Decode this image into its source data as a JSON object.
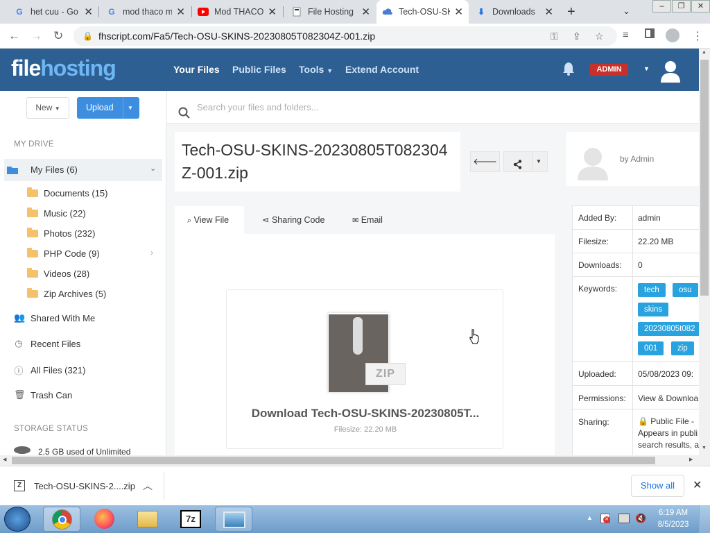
{
  "browser": {
    "tabs": [
      {
        "title": "het cuu - Go",
        "icon": "google-icon"
      },
      {
        "title": "mod thaco m",
        "icon": "google-icon"
      },
      {
        "title": "Mod THACO",
        "icon": "youtube-icon"
      },
      {
        "title": "File Hosting",
        "icon": "filehosting-icon"
      },
      {
        "title": "Tech-OSU-SK",
        "icon": "cloud-icon",
        "active": true
      },
      {
        "title": "Downloads",
        "icon": "download-icon"
      }
    ],
    "url": "fhscript.com/Fa5/Tech-OSU-SKINS-20230805T082304Z-001.zip"
  },
  "site": {
    "logo_a": "file",
    "logo_b": "hosting",
    "nav": [
      "Your Files",
      "Public Files",
      "Tools",
      "Extend Account"
    ],
    "admin_badge": "ADMIN"
  },
  "toolbar": {
    "new_label": "New",
    "upload_label": "Upload",
    "search_placeholder": "Search your files and folders..."
  },
  "sidebar": {
    "my_drive_label": "MY DRIVE",
    "my_files": "My Files (6)",
    "folders": [
      "Documents (15)",
      "Music (22)",
      "Photos (232)",
      "PHP Code (9)",
      "Videos (28)",
      "Zip Archives (5)"
    ],
    "shared": "Shared With Me",
    "recent": "Recent Files",
    "all": "All Files (321)",
    "trash": "Trash Can",
    "storage_label": "STORAGE STATUS",
    "storage_text": "2.5 GB used of Unlimited"
  },
  "file": {
    "title": "Tech-OSU-SKINS-20230805T082304Z-001.zip",
    "owner": "by Admin",
    "tabs": [
      "View File",
      "Sharing Code",
      "Email"
    ],
    "zip_label": "ZIP",
    "download_text": "Download Tech-OSU-SKINS-20230805T...",
    "filesize_text": "Filesize: 22.20 MB"
  },
  "info": {
    "added_by_k": "Added By:",
    "added_by_v": "admin",
    "filesize_k": "Filesize:",
    "filesize_v": "22.20 MB",
    "downloads_k": "Downloads:",
    "downloads_v": "0",
    "keywords_k": "Keywords:",
    "keywords": [
      "tech",
      "osu",
      "skins",
      "20230805t082",
      "001",
      "zip"
    ],
    "uploaded_k": "Uploaded:",
    "uploaded_v": "05/08/2023 09:",
    "permissions_k": "Permissions:",
    "permissions_v": "View & Downloa",
    "sharing_k": "Sharing:",
    "sharing_l1": "Public File -",
    "sharing_l2": "Appears in publi",
    "sharing_l3": "search results, a"
  },
  "downloads_bar": {
    "filename": "Tech-OSU-SKINS-2....zip",
    "show_all": "Show all"
  },
  "taskbar": {
    "time": "6:19 AM",
    "date": "8/5/2023"
  },
  "colors": {
    "header_bg": "#2d5f92",
    "accent": "#3d8ee0",
    "keyword": "#29a3df",
    "admin_badge": "#c9302c"
  }
}
